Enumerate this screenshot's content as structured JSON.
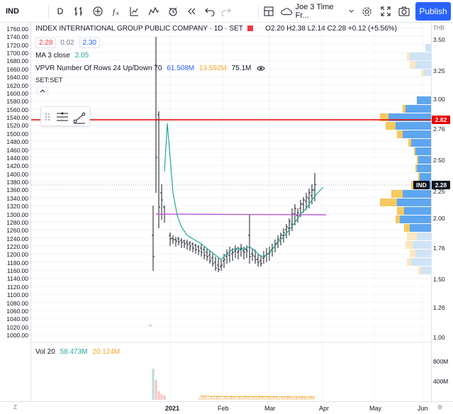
{
  "toolbar": {
    "symbol": "IND",
    "interval": "D",
    "layout_name": "Joe 3 Time Fr...",
    "publish_label": "Publish"
  },
  "legend": {
    "title": "INDEX INTERNATIONAL GROUP PUBLIC COMPANY · 1D · SET",
    "ohlc": "O2.20 H2.38 L2.14 C2.28 +0.12 (+5.56%)",
    "bid": "2.28",
    "spread": "0.02",
    "ask": "2.30",
    "ma_label": "MA 3 close",
    "ma_value": "2.05",
    "vpvr_label": "VPVR Number Of Rows 24 Up/Down 70",
    "vpvr_up": "61.508M",
    "vpvr_down": "13.592M",
    "vpvr_total": "75.1M",
    "set_label": "SET:SET"
  },
  "volume_legend": {
    "label": "Vol 20",
    "value1": "58.473M",
    "value2": "20.124M"
  },
  "left_axis": [
    "1760.00",
    "1740.00",
    "1720.00",
    "1700.00",
    "1680.00",
    "1660.00",
    "1640.00",
    "1620.00",
    "1600.00",
    "1580.00",
    "1560.00",
    "1540.00",
    "1520.00",
    "1500.00",
    "1480.00",
    "1460.00",
    "1440.00",
    "1420.00",
    "1400.00",
    "1380.00",
    "1360.00",
    "1340.00",
    "1320.00",
    "1300.00",
    "1280.00",
    "1260.00",
    "1240.00",
    "1220.00",
    "1200.00",
    "1180.00",
    "1160.00",
    "1140.00",
    "1120.00",
    "1100.00",
    "1080.00",
    "1060.00",
    "1040.00",
    "1020.00",
    "1000.00"
  ],
  "right_axis": [
    "3.50",
    "3.25",
    "3.00",
    "2.76",
    "2.50",
    "2.25",
    "2.00",
    "1.76",
    "1.50",
    "1.26",
    "1.00"
  ],
  "right_axis_top": "THB",
  "vol_axis": [
    "800M",
    "400M"
  ],
  "price_badges": {
    "resistance": "2.82",
    "symbol": "IND",
    "last": "2.28"
  },
  "time_axis": [
    {
      "label": "2021",
      "bold": true
    },
    {
      "label": "Feb",
      "bold": false
    },
    {
      "label": "Mar",
      "bold": false
    },
    {
      "label": "Apr",
      "bold": false
    },
    {
      "label": "May",
      "bold": false
    },
    {
      "label": "Jun",
      "bold": false
    }
  ],
  "colors": {
    "resistance_line": "#e60000",
    "support_line": "#c45bd6",
    "ma": "#26a69a",
    "vp_up": "#5ea6f0",
    "vp_down": "#f6c85f",
    "publish": "#2962ff"
  },
  "icons": [
    "indicators-icon",
    "financials-icon",
    "compare-icon",
    "fx-icon",
    "templates-icon",
    "alert-icon",
    "replay-icon",
    "undo-icon",
    "redo-icon",
    "layout-icon",
    "cloud-icon",
    "chevron-down-icon",
    "settings-icon",
    "fullscreen-icon",
    "camera-icon"
  ]
}
